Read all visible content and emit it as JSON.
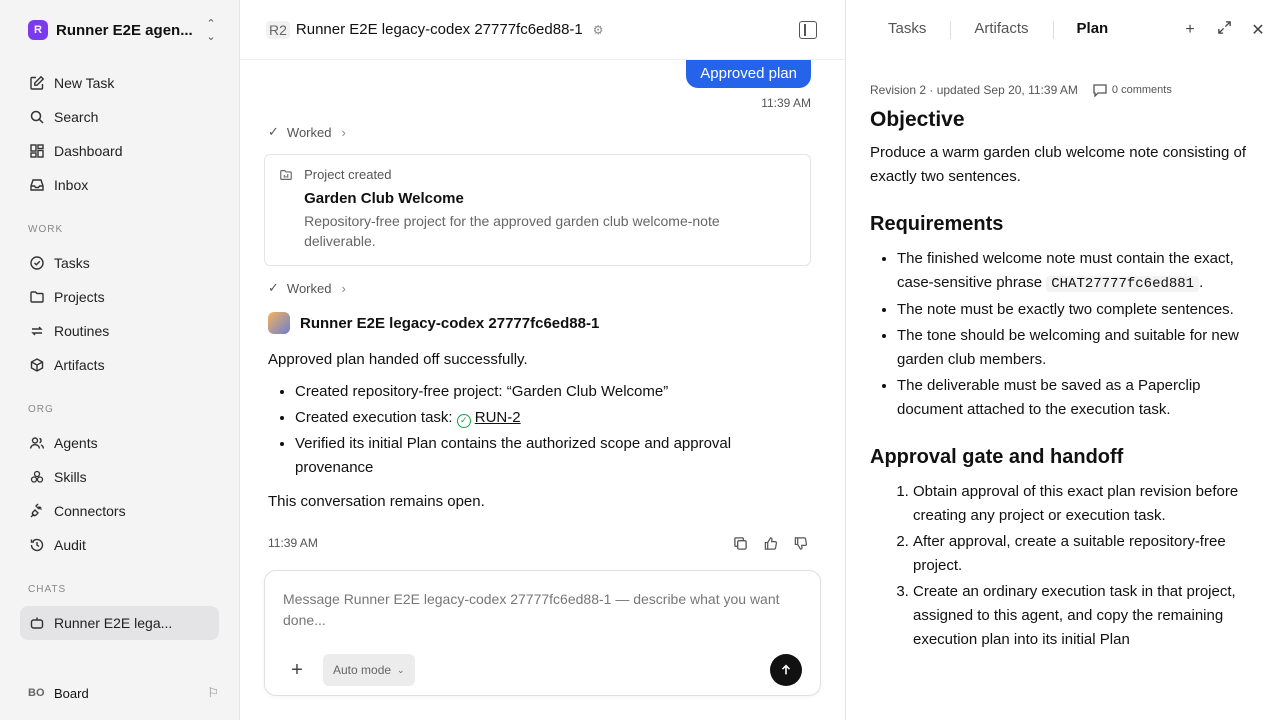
{
  "sidebar": {
    "workspace": {
      "logo": "R",
      "name": "Runner E2E agen..."
    },
    "primary": [
      {
        "label": "New Task",
        "icon": "pencil-square-icon"
      },
      {
        "label": "Search",
        "icon": "search-icon"
      },
      {
        "label": "Dashboard",
        "icon": "dashboard-icon"
      },
      {
        "label": "Inbox",
        "icon": "inbox-icon"
      }
    ],
    "work_label": "WORK",
    "work": [
      {
        "label": "Tasks",
        "icon": "check-circle-icon"
      },
      {
        "label": "Projects",
        "icon": "folder-icon"
      },
      {
        "label": "Routines",
        "icon": "repeat-icon"
      },
      {
        "label": "Artifacts",
        "icon": "cube-icon"
      }
    ],
    "org_label": "ORG",
    "org": [
      {
        "label": "Agents",
        "icon": "users-icon"
      },
      {
        "label": "Skills",
        "icon": "skills-icon"
      },
      {
        "label": "Connectors",
        "icon": "plug-icon"
      },
      {
        "label": "Audit",
        "icon": "history-icon"
      }
    ],
    "chats_label": "CHATS",
    "chat_item": "Runner E2E lega...",
    "board": {
      "initials": "BO",
      "label": "Board"
    }
  },
  "chat": {
    "badge": "R2",
    "title": "Runner E2E legacy-codex 27777fc6ed88-1",
    "user_message": "Approved plan",
    "user_time": "11:39 AM",
    "worked_label": "Worked",
    "card": {
      "kicker": "Project created",
      "title": "Garden Club Welcome",
      "description": "Repository-free project for the approved garden club welcome-note deliverable."
    },
    "worked_label_2": "Worked",
    "agent_name": "Runner E2E legacy-codex 27777fc6ed88-1",
    "reply_intro": "Approved plan handed off successfully.",
    "bullets": [
      "Created repository-free project: “Garden Club Welcome”",
      "Verified its initial Plan contains the authorized scope and approval provenance"
    ],
    "task_prefix": "Created execution task: ",
    "task_link": "RUN-2",
    "reply_outro": "This conversation remains open.",
    "reply_time": "11:39 AM",
    "composer": {
      "placeholder": "Message Runner E2E legacy-codex 27777fc6ed88-1 — describe what you want done...",
      "mode": "Auto mode"
    }
  },
  "panel": {
    "tabs": [
      "Tasks",
      "Artifacts",
      "Plan"
    ],
    "active_tab": "Plan",
    "meta": "Revision 2 · updated Sep 20, 11:39 AM",
    "comments": "0 comments",
    "objective_heading": "Objective",
    "objective_text": "Produce a warm garden club welcome note consisting of exactly two sentences.",
    "requirements_heading": "Requirements",
    "req_1_before": "The finished welcome note must contain the exact, case-sensitive phrase ",
    "req_1_code": "CHAT27777fc6ed881",
    "req_1_after": ".",
    "requirements": [
      "The note must be exactly two complete sentences.",
      "The tone should be welcoming and suitable for new garden club members.",
      "The deliverable must be saved as a Paperclip document attached to the execution task."
    ],
    "approval_heading": "Approval gate and handoff",
    "steps": [
      "Obtain approval of this exact plan revision before creating any project or execution task.",
      "After approval, create a suitable repository-free project.",
      "Create an ordinary execution task in that project, assigned to this agent, and copy the remaining execution plan into its initial Plan"
    ]
  }
}
